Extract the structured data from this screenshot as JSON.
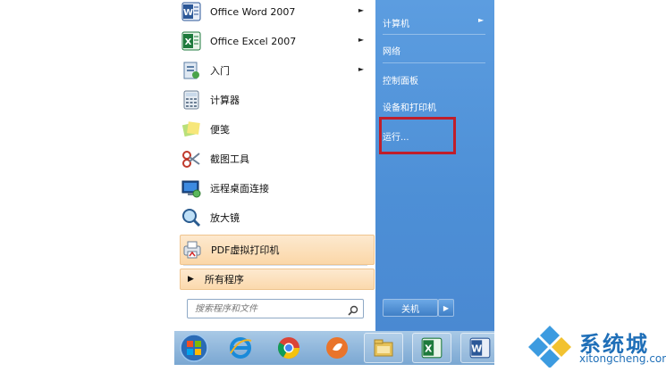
{
  "start_menu": {
    "programs": [
      {
        "label": "Office Word 2007",
        "icon": "word-icon",
        "has_arrow": true
      },
      {
        "label": "Office Excel 2007",
        "icon": "excel-icon",
        "has_arrow": true
      },
      {
        "label": "入门",
        "icon": "getting-started-icon",
        "has_arrow": true
      },
      {
        "label": "计算器",
        "icon": "calculator-icon",
        "has_arrow": false
      },
      {
        "label": "便笺",
        "icon": "sticky-notes-icon",
        "has_arrow": false
      },
      {
        "label": "截图工具",
        "icon": "snipping-tool-icon",
        "has_arrow": false
      },
      {
        "label": "远程桌面连接",
        "icon": "remote-desktop-icon",
        "has_arrow": false
      },
      {
        "label": "放大镜",
        "icon": "magnifier-icon",
        "has_arrow": false
      },
      {
        "label": "PDF虚拟打印机",
        "icon": "pdf-printer-icon",
        "has_arrow": true
      }
    ],
    "all_programs_label": "所有程序",
    "search_placeholder": "搜索程序和文件",
    "right_items": [
      {
        "label": "计算机",
        "has_arrow": true
      },
      {
        "label": "网络",
        "has_arrow": false
      },
      {
        "label": "控制面板",
        "has_arrow": false
      },
      {
        "label": "设备和打印机",
        "has_arrow": false
      },
      {
        "label": "运行...",
        "has_arrow": false
      }
    ],
    "shutdown_label": "关机"
  },
  "taskbar": {
    "items": [
      "start-orb-icon",
      "internet-explorer-icon",
      "chrome-icon",
      "media-player-icon",
      "file-explorer-icon",
      "excel-icon",
      "word-icon"
    ]
  },
  "watermark": {
    "name": "系统城",
    "url": "xitongcheng.com"
  },
  "colors": {
    "right_pane": "#4d8fd6",
    "highlight_box": "#c01e2a",
    "brand": "#1f6fb8"
  }
}
